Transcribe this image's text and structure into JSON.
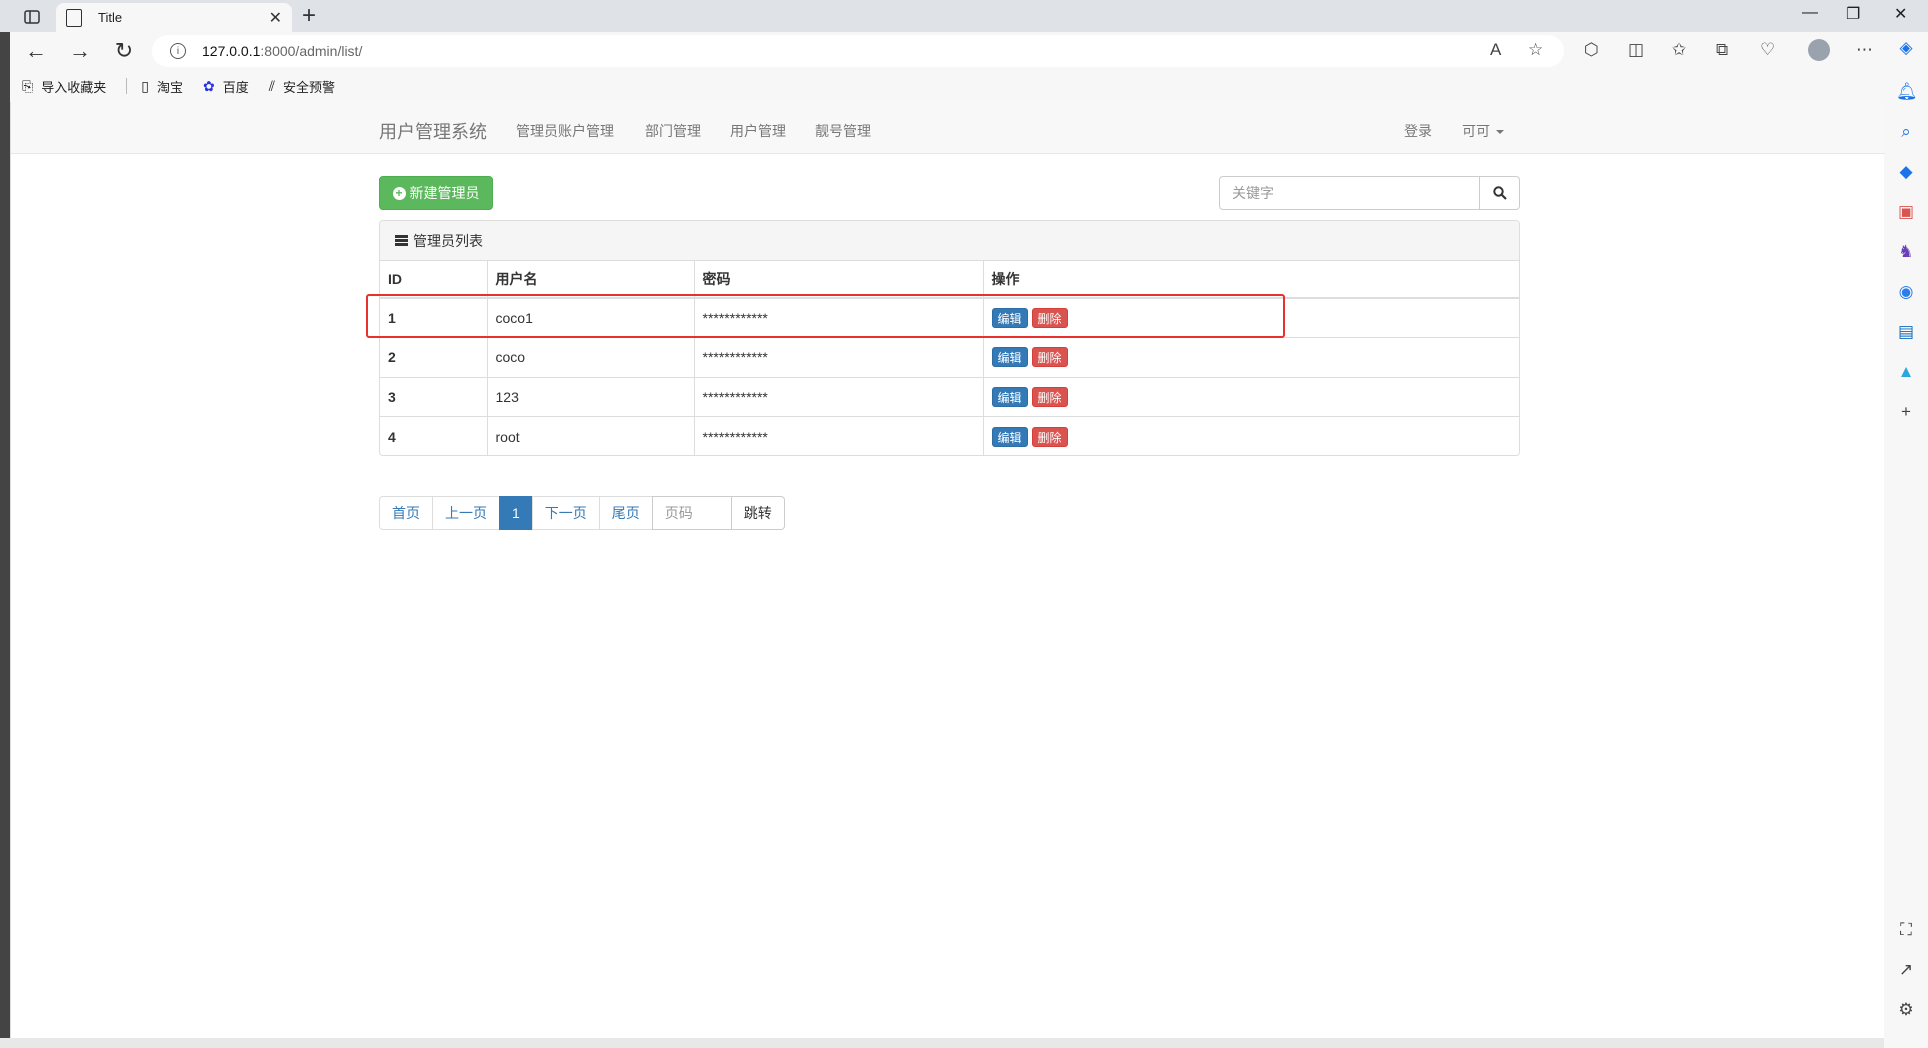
{
  "browser": {
    "tab_title": "Title",
    "url_host": "127.0.0.1",
    "url_path": ":8000/admin/list/",
    "bookmarks": [
      "导入收藏夹",
      "淘宝",
      "百度",
      "安全预警"
    ]
  },
  "navbar": {
    "brand": "用户管理系统",
    "links": [
      "管理员账户管理",
      "部门管理",
      "用户管理",
      "靓号管理"
    ],
    "login": "登录",
    "user": "可可"
  },
  "toolbar": {
    "add_label": "新建管理员",
    "search_placeholder": "关键字"
  },
  "panel": {
    "title": "管理员列表",
    "columns": [
      "ID",
      "用户名",
      "密码",
      "操作"
    ],
    "rows": [
      {
        "id": "1",
        "username": "coco1",
        "password": "************"
      },
      {
        "id": "2",
        "username": "coco",
        "password": "************"
      },
      {
        "id": "3",
        "username": "123",
        "password": "************"
      },
      {
        "id": "4",
        "username": "root",
        "password": "************"
      }
    ],
    "edit_label": "编辑",
    "delete_label": "删除"
  },
  "pagination": {
    "first": "首页",
    "prev": "上一页",
    "current": "1",
    "next": "下一页",
    "last": "尾页",
    "page_placeholder": "页码",
    "go": "跳转"
  },
  "colors": {
    "success": "#5cb85c",
    "primary": "#337ab7",
    "danger": "#d9534f",
    "highlight": "#e8312c"
  }
}
